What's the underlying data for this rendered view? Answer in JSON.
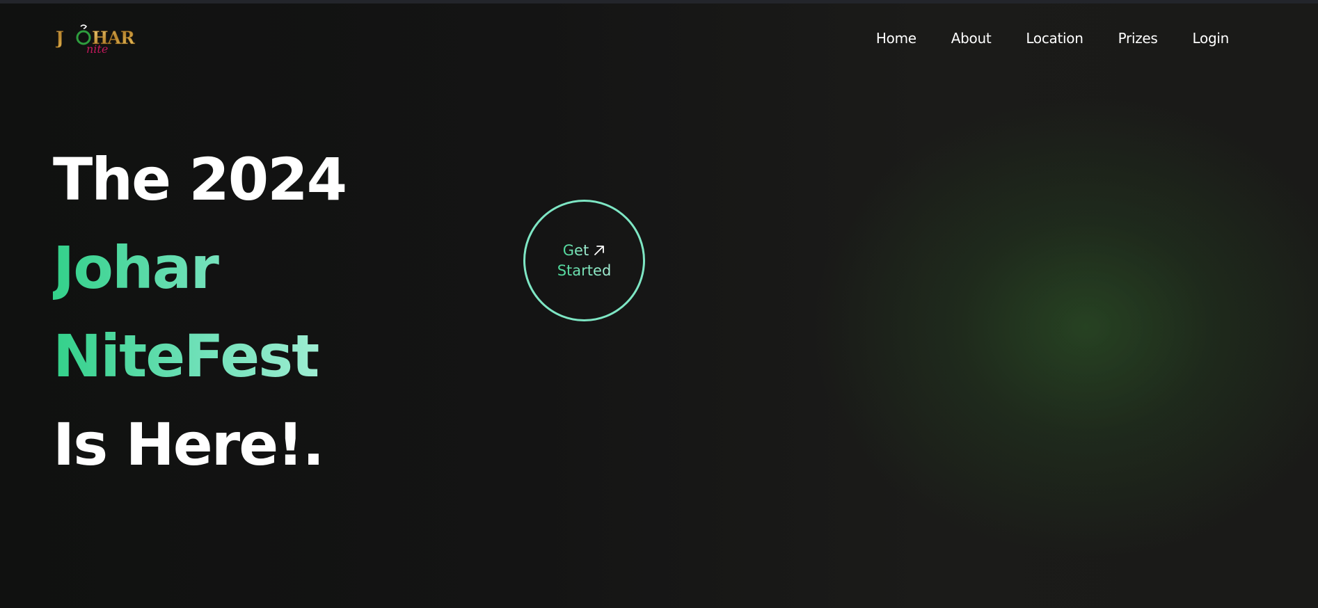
{
  "brand": {
    "logo_main": "JOHAR",
    "logo_sub": "nite",
    "colors": {
      "logo_gold": "#e6b84a",
      "logo_pink": "#c2185b",
      "logo_green": "#2e9d3e"
    }
  },
  "nav": {
    "items": [
      {
        "label": "Home"
      },
      {
        "label": "About"
      },
      {
        "label": "Location"
      },
      {
        "label": "Prizes"
      },
      {
        "label": "Login"
      }
    ]
  },
  "hero": {
    "line1": "The 2024",
    "line2": "Johar",
    "line3": "NiteFest",
    "line4": "Is Here!."
  },
  "cta": {
    "line1": "Get",
    "line2": "Started",
    "icon": "arrow-up-right-icon"
  },
  "theme": {
    "accent": "#33d18a",
    "accent_light": "#a8f0d8",
    "background": "#111111",
    "glow": "#30622a"
  }
}
